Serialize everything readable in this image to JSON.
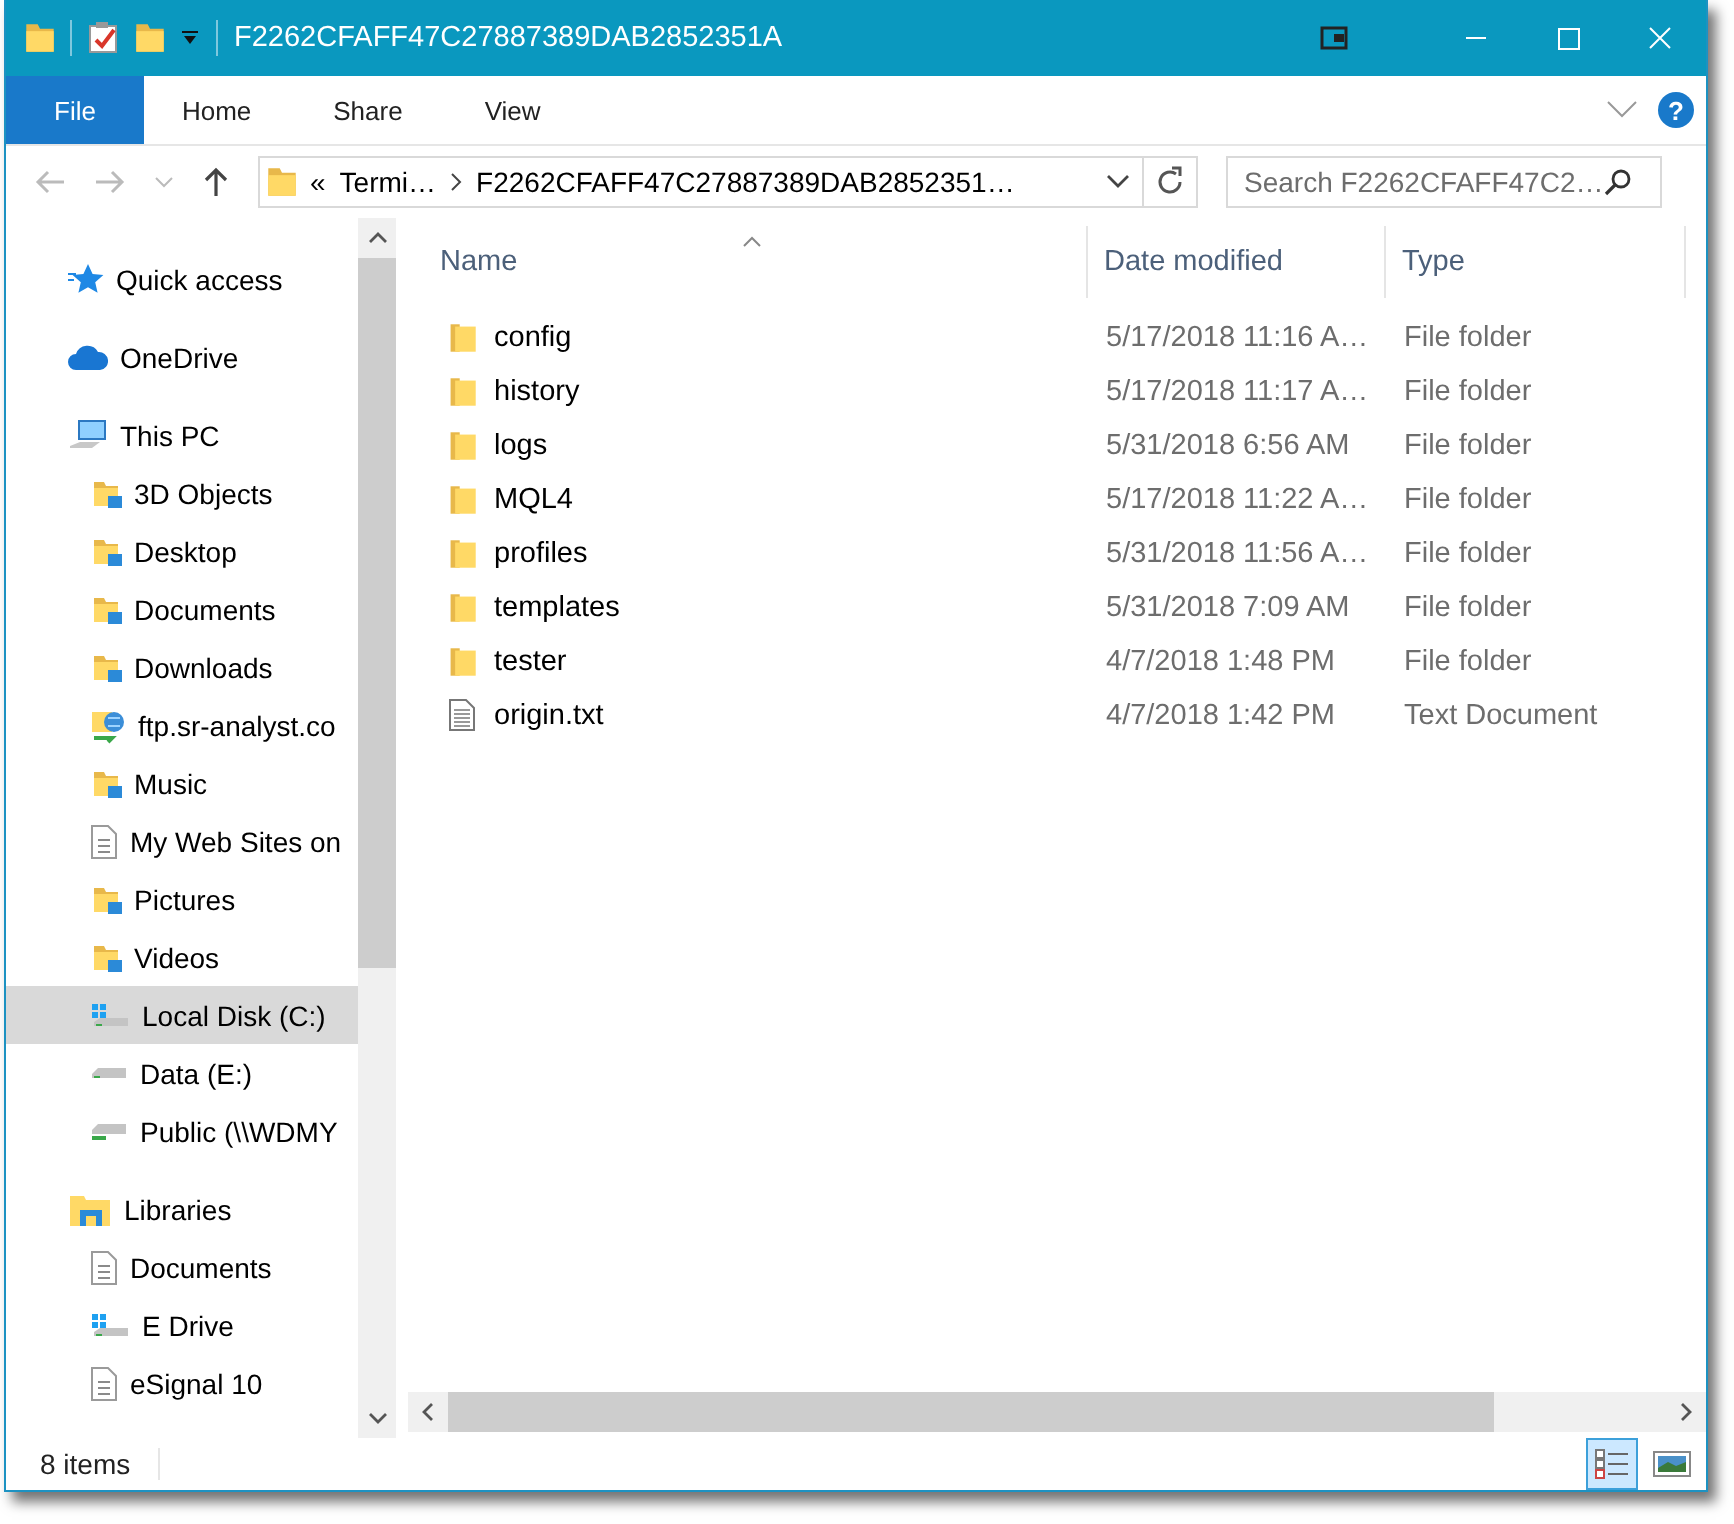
{
  "window": {
    "title": "F2262CFAFF47C27887389DAB2852351A"
  },
  "ribbon": {
    "tabs": [
      {
        "label": "File",
        "selected": true
      },
      {
        "label": "Home",
        "selected": false
      },
      {
        "label": "Share",
        "selected": false
      },
      {
        "label": "View",
        "selected": false
      }
    ],
    "help": "?"
  },
  "address_bar": {
    "overflow": "«",
    "segments": [
      "Termi…",
      "F2262CFAFF47C27887389DAB2852351…"
    ]
  },
  "search": {
    "placeholder": "Search F2262CFAFF47C2…"
  },
  "navigation": {
    "items": [
      {
        "label": "Quick access",
        "kind": "star",
        "selected": false
      },
      {
        "label": "OneDrive",
        "kind": "cloud",
        "selected": false
      },
      {
        "label": "This PC",
        "kind": "computer",
        "selected": false,
        "children": [
          {
            "label": "3D Objects",
            "kind": "folder",
            "selected": false
          },
          {
            "label": "Desktop",
            "kind": "folder",
            "selected": false
          },
          {
            "label": "Documents",
            "kind": "folder",
            "selected": false
          },
          {
            "label": "Downloads",
            "kind": "folder",
            "selected": false
          },
          {
            "label": "ftp.sr-analyst.co",
            "kind": "globe",
            "selected": false
          },
          {
            "label": "Music",
            "kind": "folder",
            "selected": false
          },
          {
            "label": "My Web Sites on",
            "kind": "page",
            "selected": false
          },
          {
            "label": "Pictures",
            "kind": "folder",
            "selected": false
          },
          {
            "label": "Videos",
            "kind": "folder",
            "selected": false
          },
          {
            "label": "Local Disk (C:)",
            "kind": "system-drive",
            "selected": true
          },
          {
            "label": "Data (E:)",
            "kind": "drive",
            "selected": false
          },
          {
            "label": "Public (\\\\WDMY",
            "kind": "network-drive",
            "selected": false
          }
        ]
      },
      {
        "label": "Libraries",
        "kind": "library",
        "selected": false,
        "children": [
          {
            "label": "Documents",
            "kind": "page",
            "selected": false
          },
          {
            "label": "E Drive",
            "kind": "system-drive",
            "selected": false
          },
          {
            "label": "eSignal 10",
            "kind": "page",
            "selected": false
          }
        ]
      }
    ]
  },
  "file_list": {
    "columns": [
      {
        "label": "Name",
        "sorted": true
      },
      {
        "label": "Date modified",
        "sorted": false
      },
      {
        "label": "Type",
        "sorted": false
      }
    ],
    "rows": [
      {
        "name": "config",
        "date": "5/17/2018 11:16 A…",
        "type": "File folder",
        "kind": "folder"
      },
      {
        "name": "history",
        "date": "5/17/2018 11:17 A…",
        "type": "File folder",
        "kind": "folder"
      },
      {
        "name": "logs",
        "date": "5/31/2018 6:56 AM",
        "type": "File folder",
        "kind": "folder"
      },
      {
        "name": "MQL4",
        "date": "5/17/2018 11:22 A…",
        "type": "File folder",
        "kind": "folder"
      },
      {
        "name": "profiles",
        "date": "5/31/2018 11:56 A…",
        "type": "File folder",
        "kind": "folder"
      },
      {
        "name": "templates",
        "date": "5/31/2018 7:09 AM",
        "type": "File folder",
        "kind": "folder"
      },
      {
        "name": "tester",
        "date": "4/7/2018 1:48 PM",
        "type": "File folder",
        "kind": "folder"
      },
      {
        "name": "origin.txt",
        "date": "4/7/2018 1:42 PM",
        "type": "Text Document",
        "kind": "text-file"
      }
    ]
  },
  "status_bar": {
    "item_count": "8 items",
    "views": [
      {
        "kind": "details",
        "selected": true
      },
      {
        "kind": "large-icons",
        "selected": false
      }
    ]
  }
}
